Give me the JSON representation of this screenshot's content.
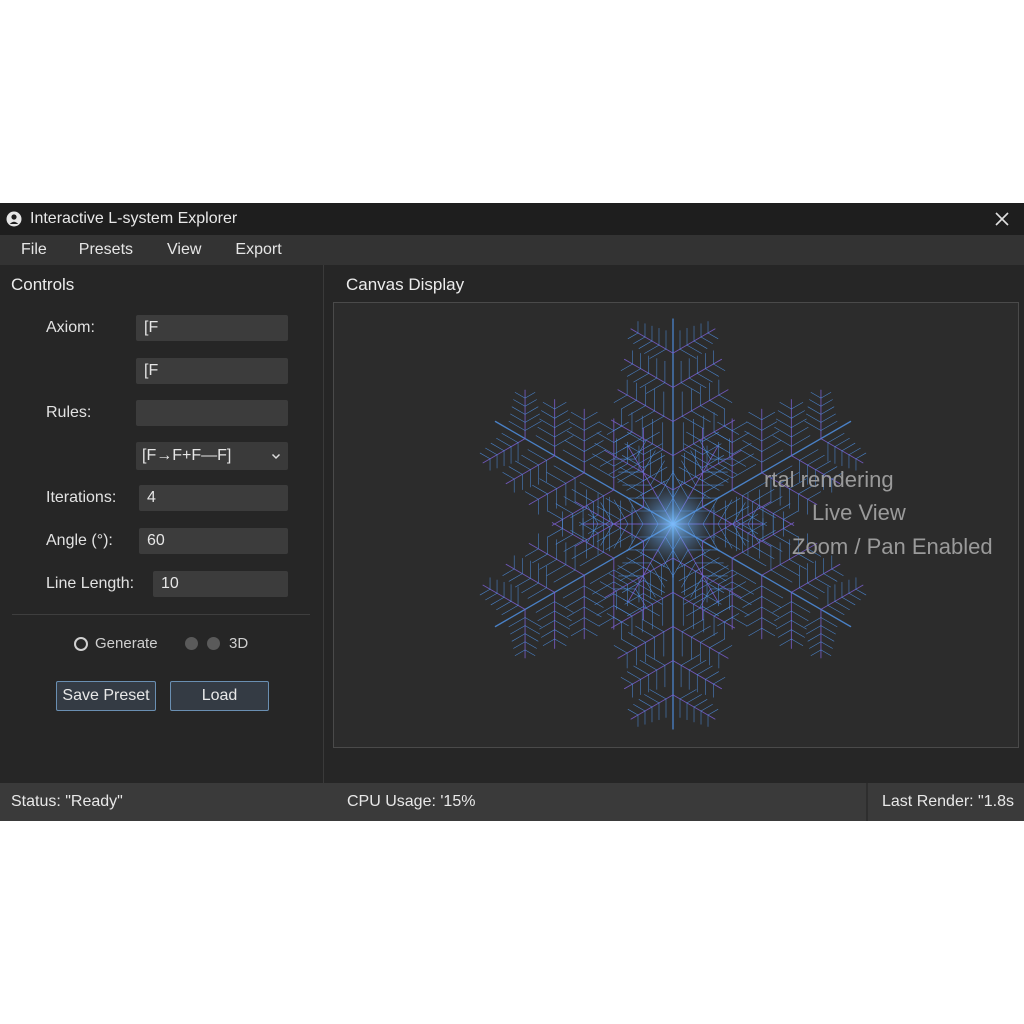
{
  "window": {
    "title": "Interactive L-system Explorer",
    "icon": "app-logo-icon",
    "close_icon": "close-icon"
  },
  "menu": {
    "items": [
      {
        "label": "File"
      },
      {
        "label": "Presets"
      },
      {
        "label": "View"
      },
      {
        "label": "Export"
      }
    ]
  },
  "controls": {
    "title": "Controls",
    "axiom_label": "Axiom:",
    "axiom_value": "[F",
    "axiom_value_2": "[F",
    "rules_label": "Rules:",
    "rules_value": "",
    "rules_select": "[F→F+F—F]",
    "iterations_label": "Iterations:",
    "iterations_value": "4",
    "angle_label": "Angle (°):",
    "angle_value": "60",
    "line_length_label": "Line Length:",
    "line_length_value": "10",
    "generate_label": "Generate",
    "mode_3d_label": "3D",
    "save_preset_label": "Save Preset",
    "load_label": "Load"
  },
  "canvas": {
    "title": "Canvas Display",
    "overlay_lines": [
      "rtal rendering",
      "Live View",
      "Zoom / Pan Enabled"
    ],
    "colors": {
      "fractal_blue": "#4f8fe0",
      "fractal_purple": "#7a5fd0",
      "center_glow": "#6ab0ff"
    }
  },
  "status": {
    "status_text": "Status: \"Ready\"",
    "cpu_text": "CPU Usage: '15%",
    "render_text": "Last Render: \"1.8s"
  }
}
